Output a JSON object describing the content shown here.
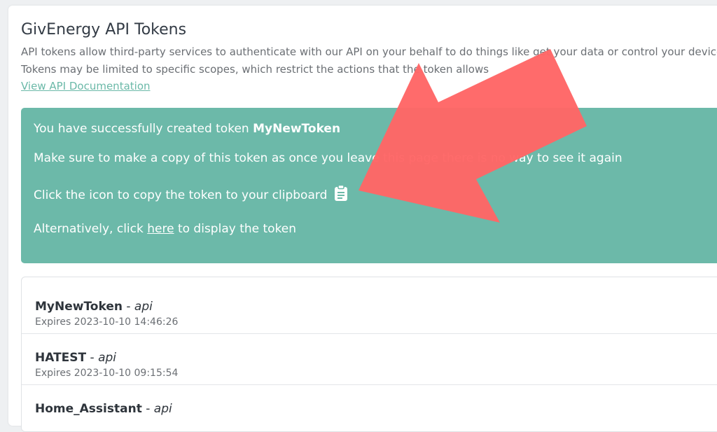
{
  "page": {
    "title": "GivEnergy API Tokens",
    "description_line1": "API tokens allow third-party services to authenticate with our API on your behalf to do things like get your data or control your devices",
    "description_line2": "Tokens may be limited to specific scopes, which restrict the actions that the token allows",
    "docs_link": "View API Documentation"
  },
  "alert": {
    "created_prefix": "You have successfully created token ",
    "token_name": "MyNewToken",
    "copy_warning": "Make sure to make a copy of this token as once you leave this page there is no way to see it again",
    "copy_instruction": "Click the icon to copy the token to your clipboard",
    "alt_prefix": "Alternatively, click ",
    "alt_link": "here",
    "alt_suffix": " to display the token",
    "icon": "clipboard-icon"
  },
  "tokens": [
    {
      "name": "MyNewToken",
      "sep": " - ",
      "scope": "api",
      "expires": "Expires 2023-10-10 14:46:26"
    },
    {
      "name": "HATEST",
      "sep": " - ",
      "scope": "api",
      "expires": "Expires 2023-10-10 09:15:54"
    },
    {
      "name": "Home_Assistant",
      "sep": " - ",
      "scope": "api",
      "expires": ""
    }
  ],
  "colors": {
    "accent": "#6cb9a9",
    "annotation_arrow": "#ff6666"
  }
}
